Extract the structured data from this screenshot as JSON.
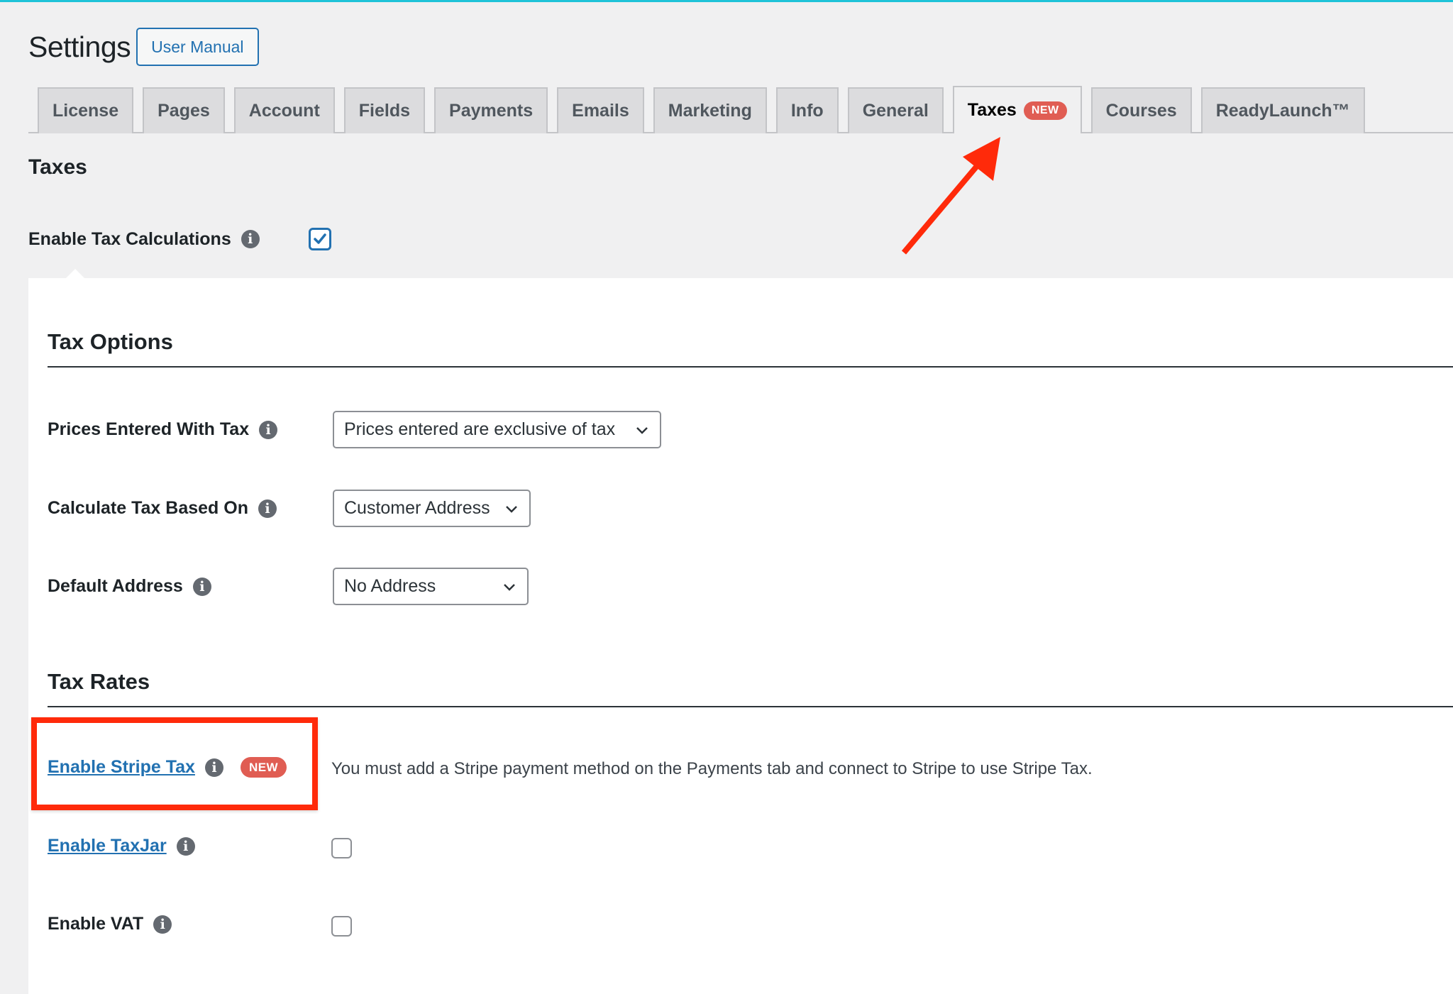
{
  "header": {
    "title": "Settings",
    "user_manual_label": "User Manual"
  },
  "tabs": [
    {
      "label": "License",
      "active": false
    },
    {
      "label": "Pages",
      "active": false
    },
    {
      "label": "Account",
      "active": false
    },
    {
      "label": "Fields",
      "active": false
    },
    {
      "label": "Payments",
      "active": false
    },
    {
      "label": "Emails",
      "active": false
    },
    {
      "label": "Marketing",
      "active": false
    },
    {
      "label": "Info",
      "active": false
    },
    {
      "label": "General",
      "active": false
    },
    {
      "label": "Taxes",
      "active": true,
      "badge": "NEW"
    },
    {
      "label": "Courses",
      "active": false
    },
    {
      "label": "ReadyLaunch™",
      "active": false
    }
  ],
  "section": {
    "title": "Taxes",
    "enable_tax_calculations": {
      "label": "Enable Tax Calculations",
      "checked": true
    }
  },
  "tax_options": {
    "heading": "Tax Options",
    "fields": [
      {
        "label": "Prices Entered With Tax",
        "value": "Prices entered are exclusive of tax"
      },
      {
        "label": "Calculate Tax Based On",
        "value": "Customer Address"
      },
      {
        "label": "Default Address",
        "value": "No Address"
      }
    ]
  },
  "tax_rates": {
    "heading": "Tax Rates",
    "stripe": {
      "label": "Enable Stripe Tax",
      "badge": "NEW",
      "description": "You must add a Stripe payment method on the Payments tab and connect to Stripe to use Stripe Tax."
    },
    "taxjar": {
      "label": "Enable TaxJar",
      "checked": false
    },
    "vat": {
      "label": "Enable VAT",
      "checked": false
    }
  },
  "colors": {
    "accent": "#2271b1",
    "badge": "#e05d53",
    "annotation": "#ff2a0a",
    "background": "#f0f0f1"
  }
}
